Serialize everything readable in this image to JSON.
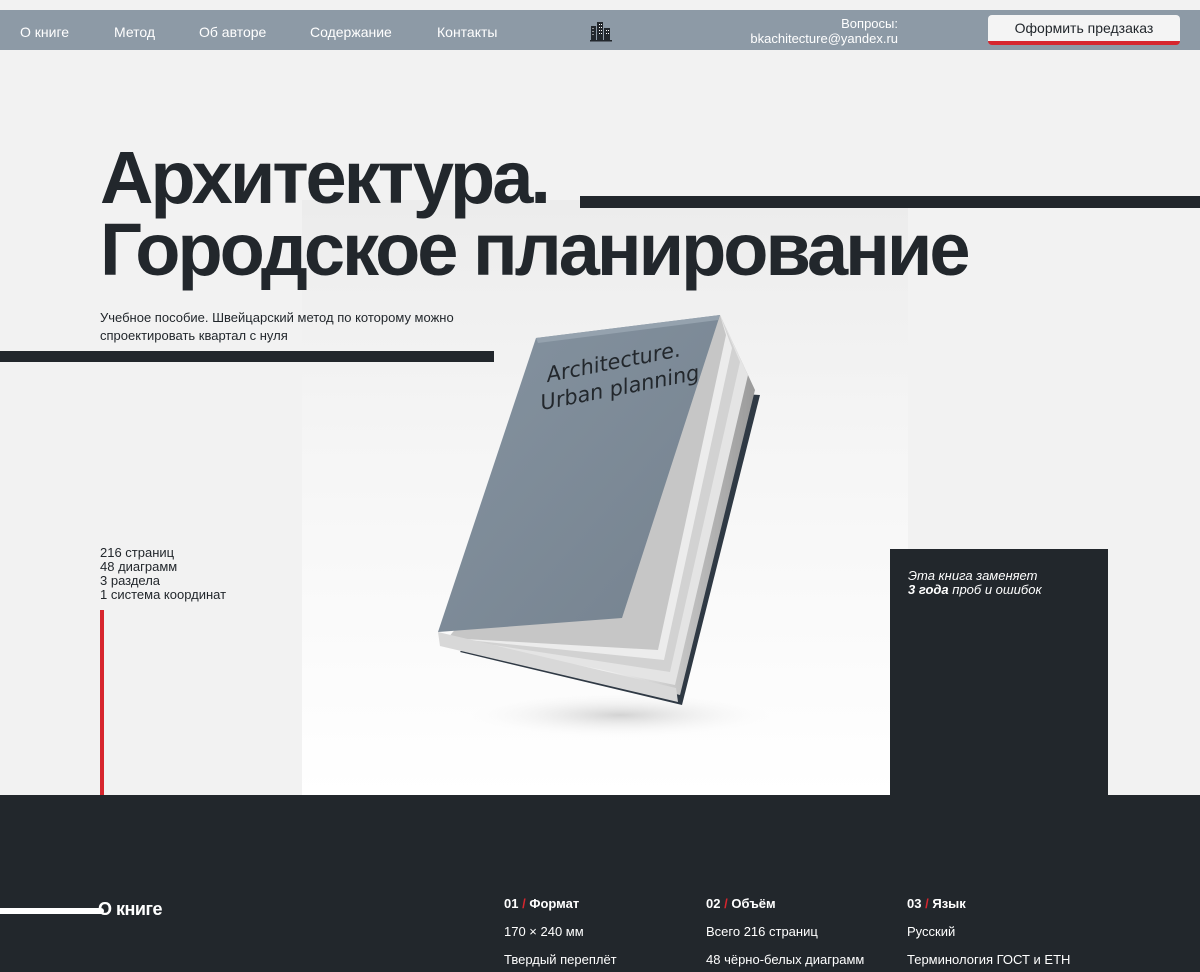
{
  "nav": {
    "items": [
      "О книге",
      "Метод",
      "Об авторе",
      "Содержание",
      "Контакты"
    ],
    "logo_icon": "city-buildings-icon",
    "questions_label": "Вопросы:",
    "email": "bkachitecture@yandex.ru",
    "preorder_label": "Оформить предзаказ"
  },
  "hero": {
    "title_line1": "Архитектура.",
    "title_line2": "Городское планирование",
    "subtitle": "Учебное пособие. Швейцарский метод по которому можно спроектировать квартал с нуля",
    "stats": [
      "216 страниц",
      "48 диаграмм",
      "3 раздела",
      "1 система координат"
    ],
    "book_cover_line1": "Architecture.",
    "book_cover_line2": "Urban planning",
    "quote_line1": "Эта книга заменяет",
    "quote_bold": "3 года",
    "quote_rest": " проб и ошибок"
  },
  "about": {
    "heading": "О книге",
    "columns": [
      {
        "num": "01",
        "title": "Формат",
        "items": [
          "170 × 240 мм",
          "Твердый переплёт"
        ]
      },
      {
        "num": "02",
        "title": "Объём",
        "items": [
          "Всего 216 страниц",
          "48 чёрно-белых диаграмм"
        ]
      },
      {
        "num": "03",
        "title": "Язык",
        "items": [
          "Русский",
          "Терминология ГОСТ и ETH"
        ]
      }
    ]
  },
  "colors": {
    "nav_bg": "#8d9aa6",
    "dark": "#22272c",
    "accent_red": "#d7262e",
    "page_bg": "#f2f2f2"
  }
}
